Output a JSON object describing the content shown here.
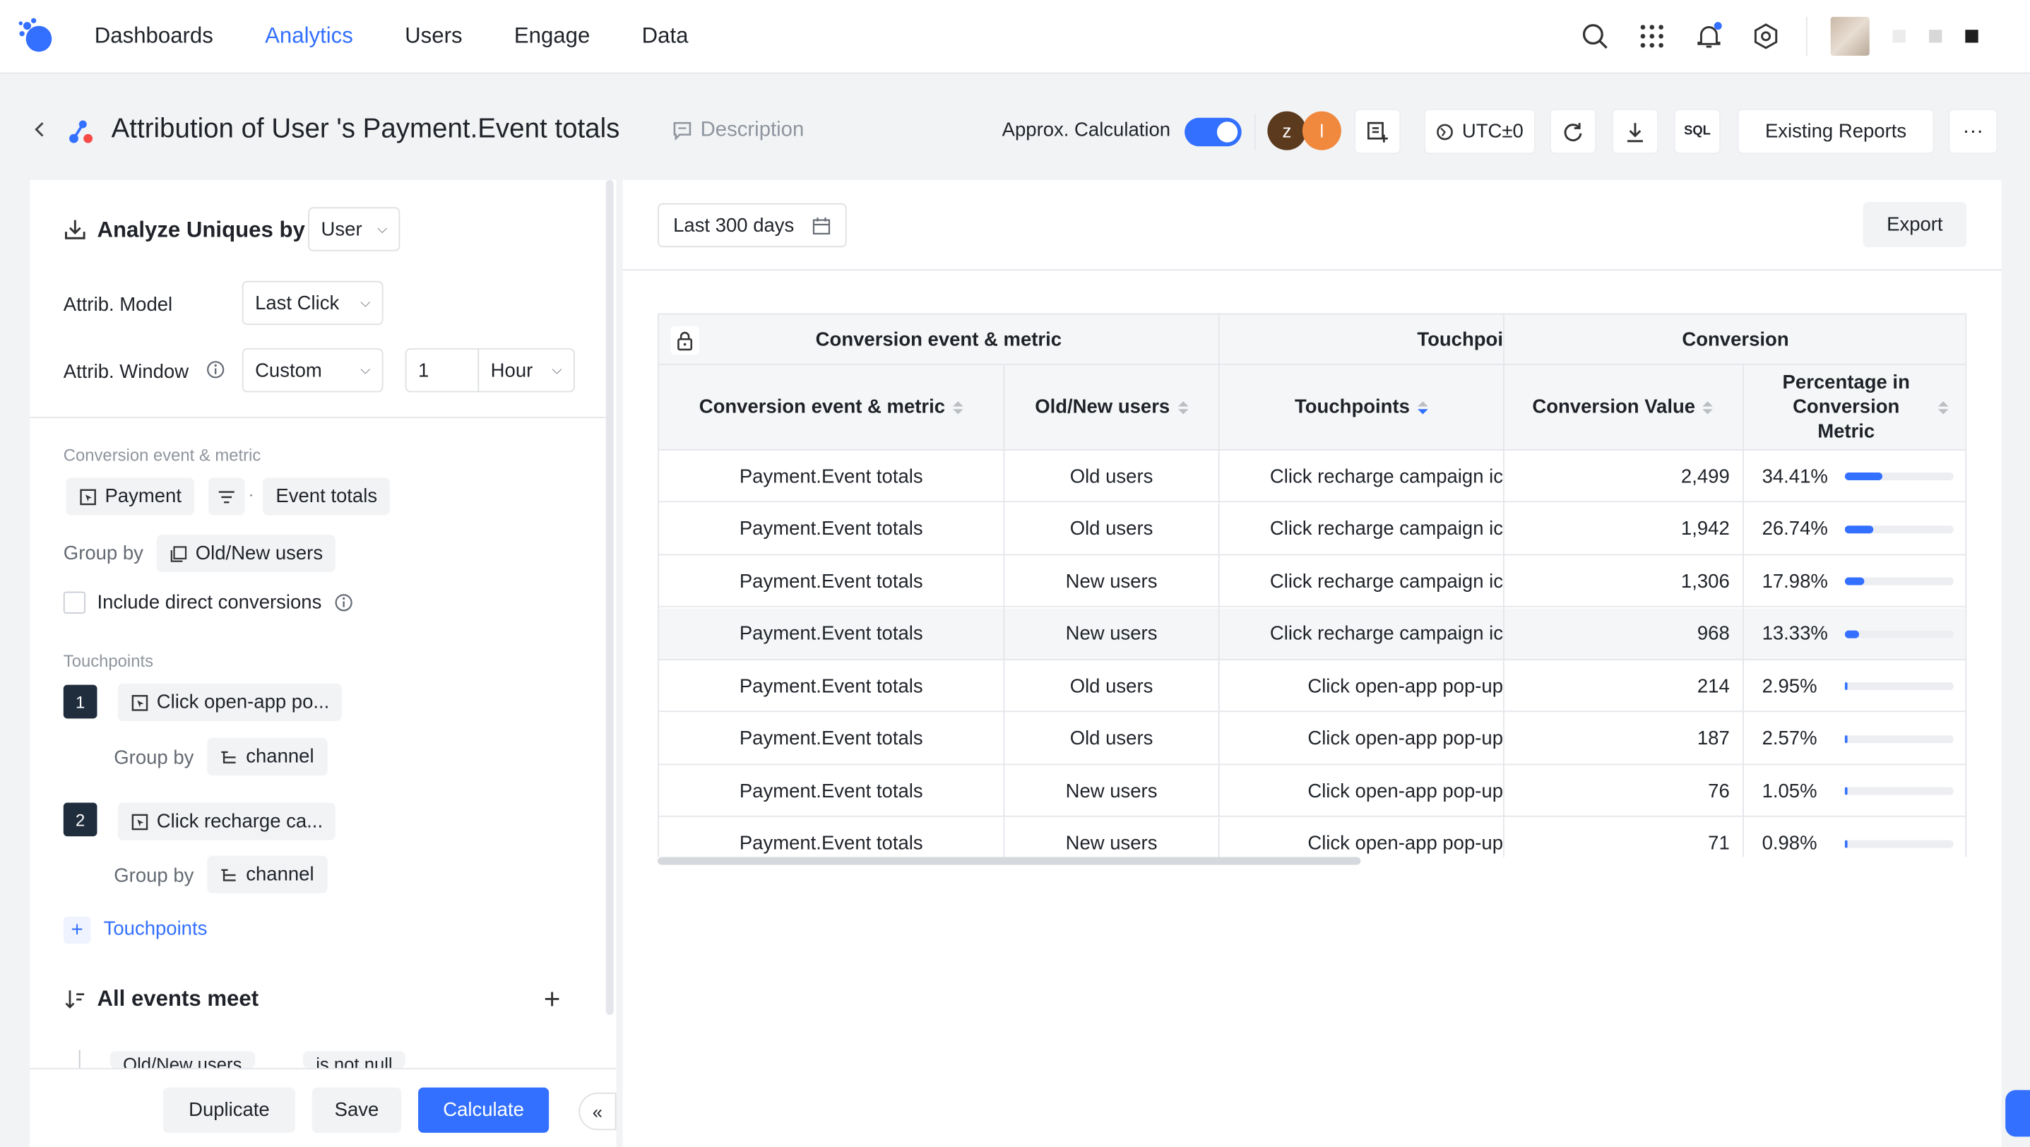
{
  "nav": {
    "items": [
      "Dashboards",
      "Analytics",
      "Users",
      "Engage",
      "Data"
    ],
    "active": "Analytics"
  },
  "header": {
    "title": "Attribution of User 's Payment.Event totals",
    "description_label": "Description",
    "approx_label": "Approx. Calculation",
    "approx_enabled": true,
    "avatars": [
      {
        "letter": "z",
        "color": "#5b3a1e"
      },
      {
        "letter": "l",
        "color": "#f0883e"
      }
    ],
    "timezone": "UTC±0",
    "sql_label": "SQL",
    "existing_reports": "Existing Reports",
    "more": "···"
  },
  "left": {
    "analyze_label": "Analyze Uniques by",
    "analyze_value": "User",
    "attrib_model_label": "Attrib. Model",
    "attrib_model_value": "Last Click",
    "attrib_window_label": "Attrib. Window",
    "attrib_window_value": "Custom",
    "window_number": "1",
    "window_unit": "Hour",
    "conversion_section": "Conversion event & metric",
    "event_chip": "Payment",
    "metric_chip": "Event totals",
    "dot": "·",
    "group_by_label": "Group by",
    "group_by_value": "Old/New users",
    "include_direct": "Include direct conversions",
    "touchpoints_section": "Touchpoints",
    "touchpoints": [
      {
        "num": "1",
        "label": "Click open-app po...",
        "group_by": "Group by",
        "group_value": "channel"
      },
      {
        "num": "2",
        "label": "Click recharge ca...",
        "group_by": "Group by",
        "group_value": "channel"
      }
    ],
    "add_touchpoints": "Touchpoints",
    "all_events_meet": "All events meet",
    "cut_chip_1": "Old/New users",
    "cut_chip_2": "is not null",
    "buttons": {
      "duplicate": "Duplicate",
      "save": "Save",
      "calculate": "Calculate"
    }
  },
  "right": {
    "date_range": "Last 300 days",
    "export": "Export"
  },
  "table": {
    "group_headers": [
      "Conversion event & metric",
      "Touchpoi",
      "Conversion"
    ],
    "columns": [
      "Conversion event & metric",
      "Old/New users",
      "Touchpoints",
      "Conversion Value",
      "Percentage in Conversion Metric"
    ],
    "rows": [
      {
        "metric": "Payment.Event totals",
        "users": "Old users",
        "touchpoint": "Click recharge campaign ic",
        "value": "2,499",
        "pct": "34.41%",
        "frac": 0.3441
      },
      {
        "metric": "Payment.Event totals",
        "users": "Old users",
        "touchpoint": "Click recharge campaign ic",
        "value": "1,942",
        "pct": "26.74%",
        "frac": 0.2674
      },
      {
        "metric": "Payment.Event totals",
        "users": "New users",
        "touchpoint": "Click recharge campaign ic",
        "value": "1,306",
        "pct": "17.98%",
        "frac": 0.1798
      },
      {
        "metric": "Payment.Event totals",
        "users": "New users",
        "touchpoint": "Click recharge campaign ic",
        "value": "968",
        "pct": "13.33%",
        "frac": 0.1333
      },
      {
        "metric": "Payment.Event totals",
        "users": "Old users",
        "touchpoint": "Click open-app pop-up",
        "value": "214",
        "pct": "2.95%",
        "frac": 0.0295
      },
      {
        "metric": "Payment.Event totals",
        "users": "Old users",
        "touchpoint": "Click open-app pop-up",
        "value": "187",
        "pct": "2.57%",
        "frac": 0.0257
      },
      {
        "metric": "Payment.Event totals",
        "users": "New users",
        "touchpoint": "Click open-app pop-up",
        "value": "76",
        "pct": "1.05%",
        "frac": 0.0105
      },
      {
        "metric": "Payment.Event totals",
        "users": "New users",
        "touchpoint": "Click open-app pop-up",
        "value": "71",
        "pct": "0.98%",
        "frac": 0.0098
      }
    ],
    "highlighted_row": 3
  }
}
